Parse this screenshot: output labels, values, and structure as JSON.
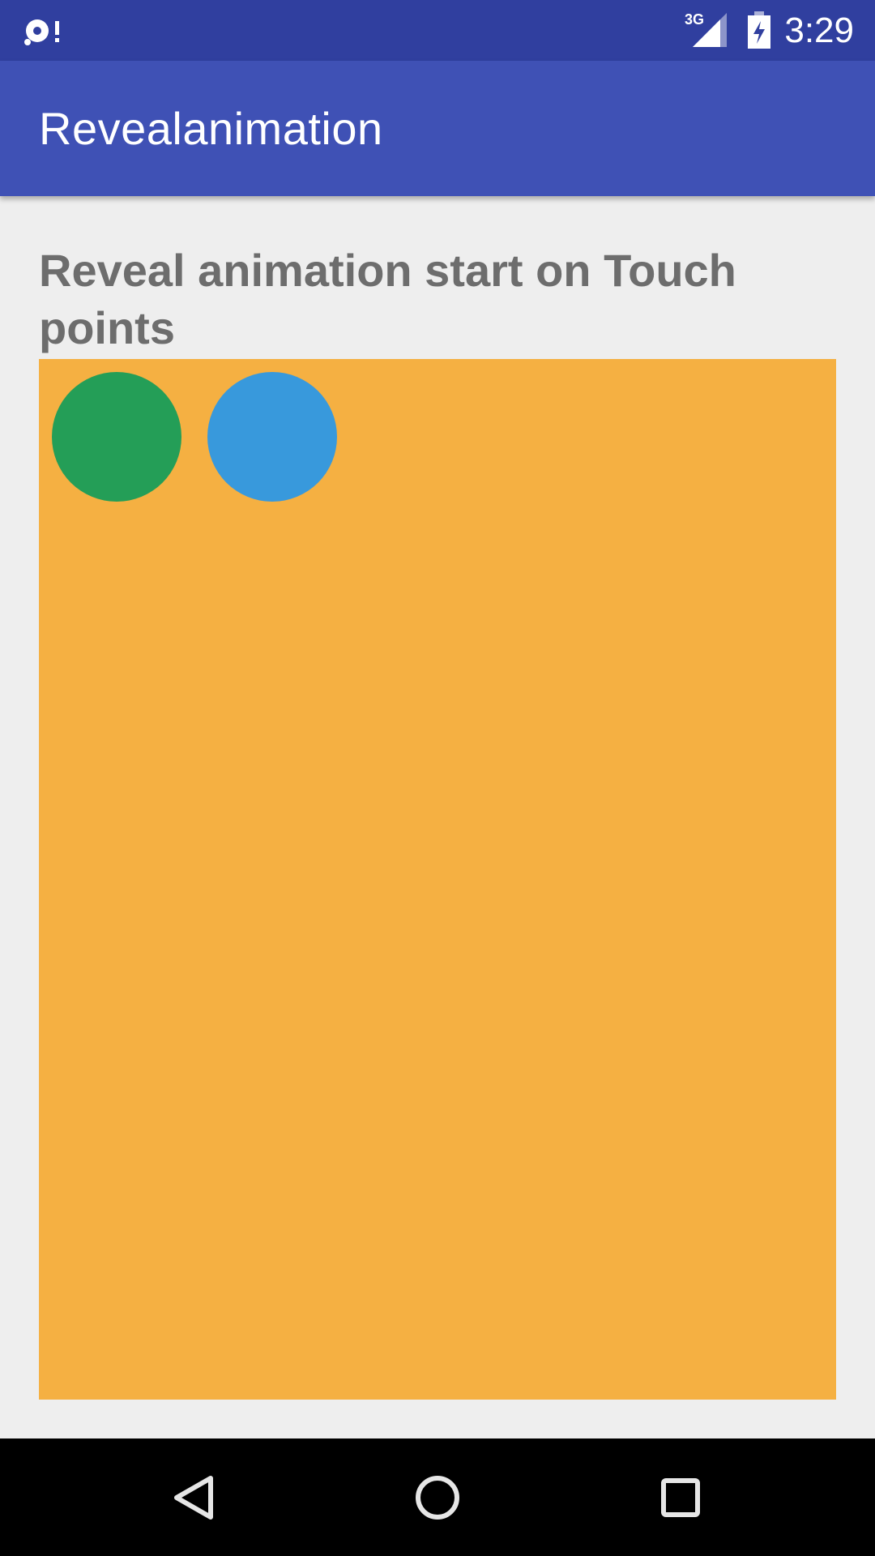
{
  "status_bar": {
    "notification_icon": "sync-alert-icon",
    "network_type": "3G",
    "signal_icon": "cell-signal-icon",
    "battery_icon": "battery-charging-icon",
    "time": "3:29"
  },
  "app_bar": {
    "title": "Revealanimation"
  },
  "content": {
    "heading": "Reveal animation start on Touch points",
    "reveal_area_color": "#f5b042",
    "circles": [
      {
        "name": "green-circle",
        "color": "#249e57"
      },
      {
        "name": "blue-circle",
        "color": "#3899dc"
      }
    ]
  },
  "nav_bar": {
    "back_icon": "back-triangle-icon",
    "home_icon": "home-circle-icon",
    "recents_icon": "recents-square-icon"
  },
  "colors": {
    "status_bar": "#303f9f",
    "app_bar": "#3f51b5",
    "background": "#eeeeee",
    "heading_text": "#6d6d6d"
  }
}
